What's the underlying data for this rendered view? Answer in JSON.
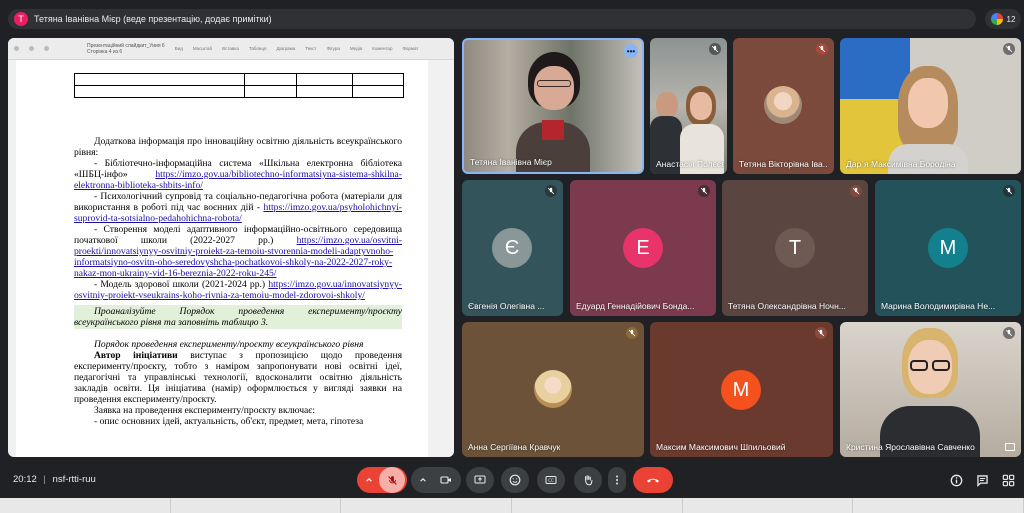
{
  "top": {
    "avatar_letter": "Т",
    "title": "Тетяна Іванівна Мієр (веде презентацію, додає примітки)",
    "people_count": "12"
  },
  "presentation": {
    "doc_title": "Презентаційний слайдкит_Уиия 6",
    "doc_subtitle": "Сторінка 4 из 6",
    "tools": [
      "Вид",
      "Масштаб",
      "Вставка",
      "Таблиця",
      "Діаграма",
      "Текст",
      "Фігура",
      "Медіа",
      "Коментар",
      "Формат"
    ],
    "paragraphs": {
      "p1": "Додаткова інформація про інноваційну освітню діяльність всеукраїнського рівня:",
      "p2": "- Бібліотечно-інформаційна система «Шкільна електронна бібліотека «ШБЦ-інфо»",
      "p2_link": "https://imzo.gov.ua/biblioteсhno-informatsiyna-sistema-shkilna-elektronna-biblioteka-shbits-info/",
      "p3": "- Психологічний супровід та соціально-педагогічна робота (матеріали для використання в роботі під час воєнних дій -",
      "p3_link": "https://imzo.gov.ua/psyholohichnyi-suprovid-ta-sotsialno-pedahohichna-robota/",
      "p4": "- Створення моделі адаптивного інформаційно-освітнього середовища початкової школи (2022-2027 рр.)",
      "p4_link": "https://imzo.gov.ua/osvitni-proekti/innovatsiynyy-osvitniy-proiekt-za-temoiu-stvorennia-modeli-adaptyvnoho-informatsiyno-osvitn-oho-seredovyshcha-pochatkovoi-shkoly-na-2022-2027-roky-nakaz-mon-ukrainy-vid-16-bereznia-2022-roku-245/",
      "p5": "- Модель здорової школи (2021-2024 рр.)",
      "p5_link": "https://imzo.gov.ua/innovatsiynyy-osvitniy-proiekt-vseukrains-koho-rivnia-za-temoiu-model-zdorovoi-shkoly/",
      "highlight": "Проаналізуйте Порядок проведення експерименту/проєкту всеукраїнського рівня та заповніть таблицю 3.",
      "italic_heading": "Порядок проведення експерименту/проєкту всеукраїнського рівня",
      "bold_start": "Автор ініціативи",
      "p6": "виступає з пропозицією щодо проведення експерименту/проєкту, тобто з наміром запропонувати нові освітні ідеї, педагогічні та управлінські технології, вдосконалити освітню діяльність закладів освіти. Ця ініціатива (намір) оформлюється у вигляді заявки на проведення експерименту/проєкту.",
      "p7": "Заявка на проведення експерименту/проєкту включає:",
      "p8": "- опис основних ідей, актуальність, об'єкт, предмет, мета, гіпотеза"
    }
  },
  "participants": [
    {
      "name": "Тетяна Іванівна Мієр",
      "type": "video",
      "muted": false
    },
    {
      "name": "Анастасія Полєєва",
      "type": "video",
      "muted": true
    },
    {
      "name": "Тетяна Вікторівна Іва...",
      "type": "photo",
      "muted": true
    },
    {
      "name": "Дар`я Максимівна Бородіна",
      "type": "video",
      "muted": true
    },
    {
      "name": "Євгенія Олегівна ...",
      "type": "letter",
      "letter": "Є",
      "muted": true
    },
    {
      "name": "Едуард Геннадійович Бонда...",
      "type": "letter",
      "letter": "Е",
      "muted": true
    },
    {
      "name": "Тетяна Олександрівна Ночн...",
      "type": "letter",
      "letter": "Т",
      "muted": true
    },
    {
      "name": "Марина Володимирівна Не...",
      "type": "letter",
      "letter": "М",
      "muted": true
    },
    {
      "name": "Анна Сергіївна Кравчук",
      "type": "photo",
      "muted": true
    },
    {
      "name": "Максим Максимович Шпильовий",
      "type": "letter",
      "letter": "М",
      "muted": true
    },
    {
      "name": "Кристина Ярославівна Савченко",
      "type": "video",
      "muted": true
    }
  ],
  "bottom": {
    "time": "20:12",
    "separator": "|",
    "meeting_code": "nsf-rtti-ruu"
  },
  "colors": {
    "background": "#202124",
    "tile_grey": "#3c4043",
    "leave_red": "#ea4335",
    "accent_blue": "#8ab4f8"
  }
}
